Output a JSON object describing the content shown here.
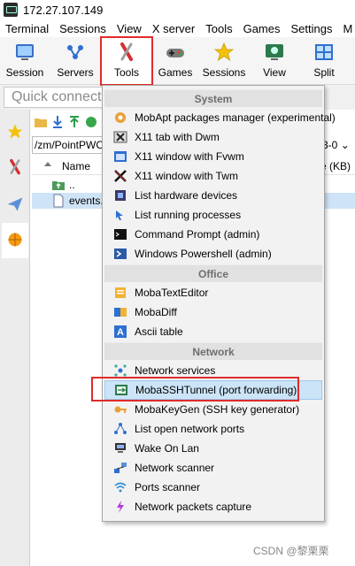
{
  "window": {
    "title": "172.27.107.149"
  },
  "menubar": {
    "items": [
      "Terminal",
      "Sessions",
      "View",
      "X server",
      "Tools",
      "Games",
      "Settings",
      "M"
    ]
  },
  "toolbar": {
    "buttons": [
      {
        "label": "Session",
        "icon": "session-icon"
      },
      {
        "label": "Servers",
        "icon": "servers-icon"
      },
      {
        "label": "Tools",
        "icon": "tools-icon"
      },
      {
        "label": "Games",
        "icon": "games-icon"
      },
      {
        "label": "Sessions",
        "icon": "star-icon"
      },
      {
        "label": "View",
        "icon": "view-icon"
      },
      {
        "label": "Split",
        "icon": "split-icon"
      }
    ]
  },
  "quick_connect": {
    "placeholder": "Quick connect"
  },
  "filebrowser": {
    "path": "/zm/PointPWCN",
    "path_suffix": "3-0",
    "columns": {
      "name": "Name",
      "size": "ze (KB)"
    },
    "rows": [
      {
        "name": ".."
      },
      {
        "name": "events."
      }
    ]
  },
  "tools_menu": {
    "sections": [
      {
        "title": "System",
        "items": [
          {
            "label": "MobApt packages manager (experimental)",
            "icon": "package-icon"
          },
          {
            "label": "X11 tab with Dwm",
            "icon": "x11-icon"
          },
          {
            "label": "X11 window with Fvwm",
            "icon": "window-icon"
          },
          {
            "label": "X11 window with Twm",
            "icon": "x11-twm-icon"
          },
          {
            "label": "List hardware devices",
            "icon": "hardware-icon"
          },
          {
            "label": "List running processes",
            "icon": "process-icon"
          },
          {
            "label": "Command Prompt (admin)",
            "icon": "cmd-icon"
          },
          {
            "label": "Windows Powershell (admin)",
            "icon": "powershell-icon"
          }
        ]
      },
      {
        "title": "Office",
        "items": [
          {
            "label": "MobaTextEditor",
            "icon": "text-editor-icon"
          },
          {
            "label": "MobaDiff",
            "icon": "diff-icon"
          },
          {
            "label": "Ascii table",
            "icon": "ascii-icon"
          }
        ]
      },
      {
        "title": "Network",
        "items": [
          {
            "label": "Network services",
            "icon": "network-services-icon"
          },
          {
            "label": "MobaSSHTunnel (port forwarding)",
            "icon": "ssh-tunnel-icon"
          },
          {
            "label": "MobaKeyGen (SSH key generator)",
            "icon": "key-icon"
          },
          {
            "label": "List open network ports",
            "icon": "ports-icon"
          },
          {
            "label": "Wake On Lan",
            "icon": "wake-on-lan-icon"
          },
          {
            "label": "Network scanner",
            "icon": "scanner-icon"
          },
          {
            "label": "Ports scanner",
            "icon": "wifi-icon"
          },
          {
            "label": "Network packets capture",
            "icon": "capture-icon"
          }
        ]
      }
    ]
  },
  "watermark": "CSDN @黎栗栗"
}
